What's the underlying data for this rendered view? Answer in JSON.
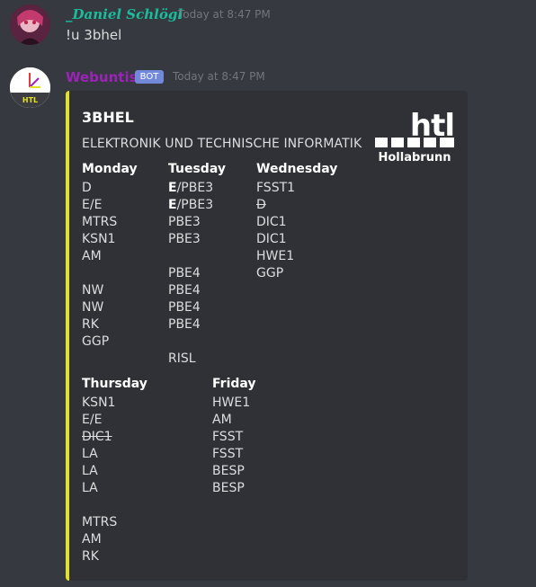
{
  "messages": [
    {
      "author": "_Daniel Schlögl",
      "author_color": "#1abc9c",
      "timestamp": "Today at 8:47 PM",
      "text": "!u 3bhel"
    },
    {
      "author": "Webuntis",
      "author_color": "#9b23b8",
      "badge": "BOT",
      "timestamp": "Today at 8:47 PM"
    }
  ],
  "embed": {
    "accent": "#e2e222",
    "title": "3BHEL",
    "description": "ELEKTRONIK UND TECHNISCHE INFORMATIK",
    "thumbnail": {
      "big": "htl",
      "small": "Hollabrunn"
    },
    "fields": [
      {
        "name": "Monday",
        "lines": [
          "D",
          "E/E",
          "MTRS",
          "KSN1",
          "AM",
          "",
          "NW",
          "NW",
          "RK",
          "GGP"
        ]
      },
      {
        "name": "Tuesday",
        "lines": [
          "E/PBE3",
          "E/PBE3",
          "PBE3",
          "PBE3",
          "",
          "PBE4",
          "PBE4",
          "PBE4",
          "PBE4",
          "",
          "RISL"
        ]
      },
      {
        "name": "Wednesday",
        "lines": [
          "FSST1",
          "D",
          "DIC1",
          "DIC1",
          "HWE1",
          "GGP"
        ]
      },
      {
        "name": "Thursday",
        "lines": [
          "KSN1",
          "E/E",
          "DIC1",
          "LA",
          "LA",
          "LA",
          "",
          "MTRS",
          "AM",
          "RK"
        ]
      },
      {
        "name": "Friday",
        "lines": [
          "HWE1",
          "AM",
          "FSST",
          "FSST",
          "BESP",
          "BESP"
        ]
      }
    ]
  },
  "avatar2_label": "HTL"
}
